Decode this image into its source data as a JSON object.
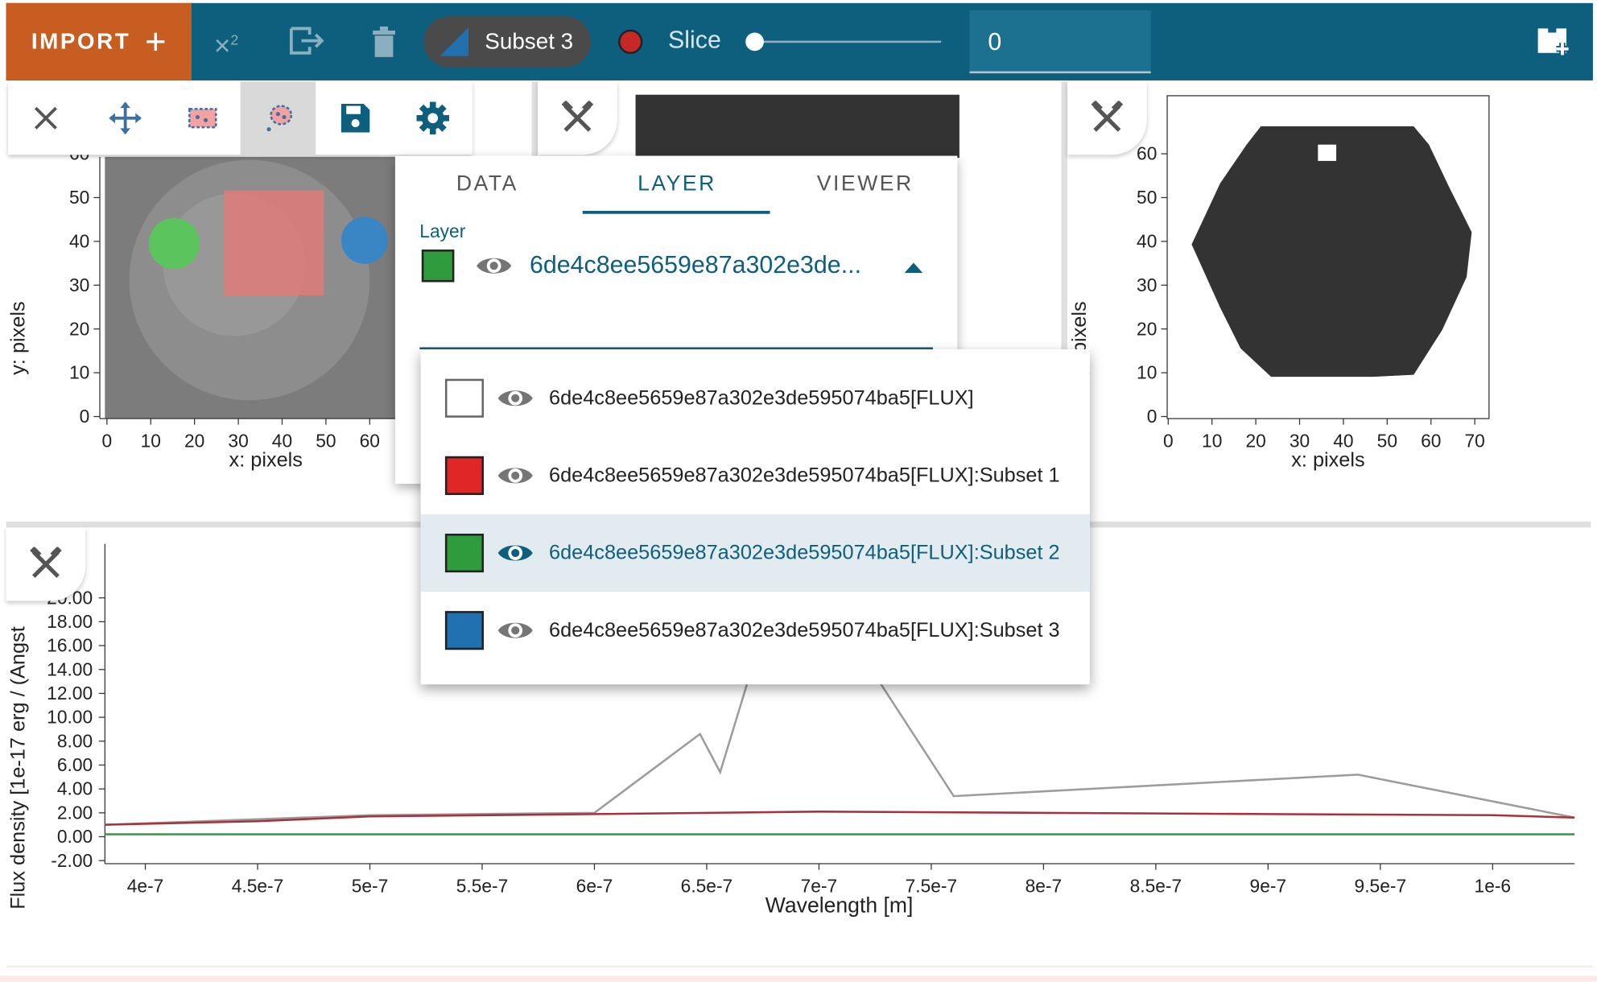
{
  "toolbar": {
    "import_label": "IMPORT",
    "subset_chip": "Subset 3",
    "slice_label": "Slice",
    "slice_value": "0",
    "slice_fraction": 0.0
  },
  "image_viewer_left": {
    "y_label": "y: pixels",
    "x_label": "x: pixels",
    "y_ticks": [
      "0",
      "10",
      "20",
      "30",
      "40",
      "50",
      "60"
    ],
    "x_ticks": [
      "0",
      "10",
      "20",
      "30",
      "40",
      "50",
      "60"
    ]
  },
  "image_viewer_right": {
    "y_label": "y: pixels",
    "x_label": "x: pixels",
    "y_ticks": [
      "0",
      "10",
      "20",
      "30",
      "40",
      "50",
      "60"
    ],
    "x_ticks": [
      "0",
      "10",
      "20",
      "30",
      "40",
      "50",
      "60",
      "70"
    ]
  },
  "menu": {
    "tabs": [
      "DATA",
      "LAYER",
      "VIEWER"
    ],
    "active_tab": "LAYER",
    "layer_label": "Layer",
    "selected_layer": "6de4c8ee5659e87a302e3de..."
  },
  "layers": [
    {
      "name": "6de4c8ee5659e87a302e3de595074ba5[FLUX]",
      "color": "#ffffff",
      "selected": false
    },
    {
      "name": "6de4c8ee5659e87a302e3de595074ba5[FLUX]:Subset 1",
      "color": "#e02626",
      "selected": false
    },
    {
      "name": "6de4c8ee5659e87a302e3de595074ba5[FLUX]:Subset 2",
      "color": "#2e9b3c",
      "selected": true
    },
    {
      "name": "6de4c8ee5659e87a302e3de595074ba5[FLUX]:Subset 3",
      "color": "#2170b0",
      "selected": false
    }
  ],
  "colors": {
    "header": "#0d5f7d",
    "import": "#c75d20",
    "subset1": "#e02626",
    "subset2": "#2e9b3c",
    "subset3": "#2170b0"
  },
  "chart_data": {
    "type": "line",
    "xlabel": "Wavelength [m]",
    "ylabel": "Flux density [1e-17 erg / (Angst",
    "x_ticks": [
      "4e-7",
      "4.5e-7",
      "5e-7",
      "5.5e-7",
      "6e-7",
      "6.5e-7",
      "7e-7",
      "7.5e-7",
      "8e-7",
      "8.5e-7",
      "9e-7",
      "9.5e-7",
      "1e-6"
    ],
    "y_ticks": [
      "-2.00",
      "0.00",
      "2.00",
      "4.00",
      "6.00",
      "8.00",
      "10.00",
      "12.00",
      "14.00",
      "16.00",
      "18.00",
      "20.00"
    ],
    "xlim": [
      3.82e-07,
      1.0365e-06
    ],
    "ylim": [
      -2.0,
      20.0
    ],
    "series": [
      {
        "color": "#9c9c9c",
        "x": [
          3.82e-07,
          5e-07,
          6e-07,
          6.47e-07,
          6.56e-07,
          6.87e-07,
          7.6e-07,
          9.4e-07,
          1.0365e-06
        ],
        "y": [
          1.0,
          1.8,
          2.0,
          8.6,
          5.4,
          27.0,
          3.4,
          5.2,
          1.6
        ]
      },
      {
        "color": "#a8323c",
        "x": [
          3.82e-07,
          4.5e-07,
          5e-07,
          6e-07,
          7e-07,
          8e-07,
          9e-07,
          1e-06,
          1.0365e-06
        ],
        "y": [
          1.0,
          1.3,
          1.7,
          1.9,
          2.1,
          2.0,
          1.9,
          1.8,
          1.6
        ]
      },
      {
        "color": "#2e9b3c",
        "x": [
          3.82e-07,
          5e-07,
          6e-07,
          7e-07,
          8e-07,
          9e-07,
          1e-06,
          1.0365e-06
        ],
        "y": [
          0.2,
          0.2,
          0.2,
          0.2,
          0.2,
          0.2,
          0.2,
          0.2
        ]
      }
    ]
  }
}
